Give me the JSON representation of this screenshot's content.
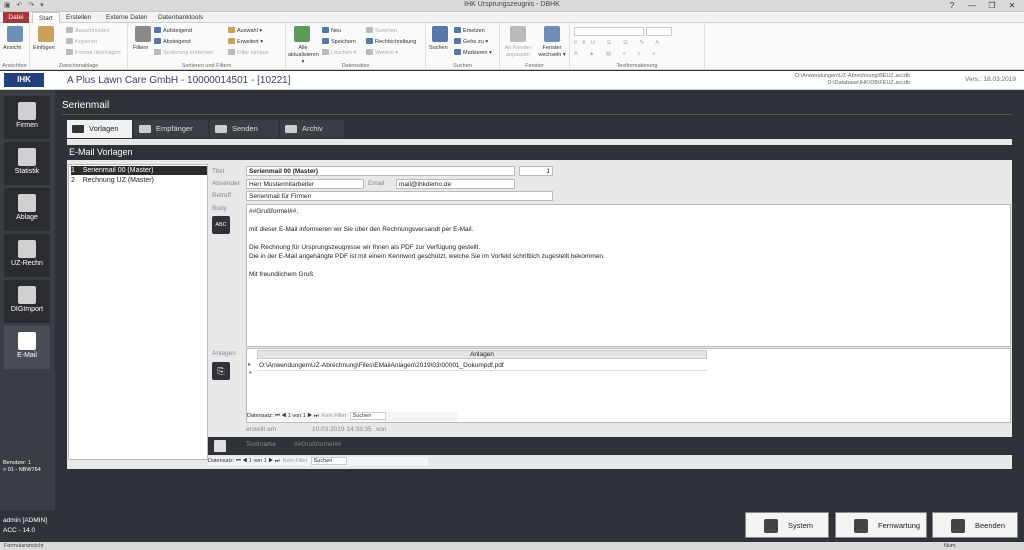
{
  "window": {
    "title": "IHK Ursprungszeugnis - DBHK",
    "min": "—",
    "restore": "❐",
    "close": "✕",
    "help": "?"
  },
  "ribbon_tabs": [
    "Datei",
    "Start",
    "Erstellen",
    "Externe Daten",
    "Datenbanktools"
  ],
  "ribbon": {
    "ansicht": {
      "btn": "Ansicht",
      "group": "Ansichten"
    },
    "clip": {
      "paste": "Einfügen",
      "cut": "Ausschneiden",
      "copy": "Kopieren",
      "format": "Format übertragen",
      "group": "Zwischenablage"
    },
    "sort": {
      "filter": "Filtern",
      "asc": "Aufsteigend",
      "desc": "Absteigend",
      "remove": "Sortierung entfernen",
      "sel": "Auswahl ▾",
      "adv": "Erweitert ▾",
      "toggle": "Filter ein/aus",
      "group": "Sortieren und Filtern"
    },
    "records": {
      "refresh": "Alle aktualisieren ▾",
      "new": "Neu",
      "save": "Speichern",
      "delete": "Löschen ▾",
      "sum": "Summen",
      "spell": "Rechtschreibung",
      "more": "Weitere ▾",
      "group": "Datensätze"
    },
    "find": {
      "search": "Suchen",
      "replace": "Ersetzen",
      "goto": "Gehe zu ▾",
      "mark": "Markieren ▾",
      "group": "Suchen"
    },
    "window": {
      "fit": "An Fenster anpassen",
      "switch": "Fenster wechseln ▾",
      "group": "Fenster"
    },
    "text": {
      "group": "Textformatierung"
    }
  },
  "header": {
    "logo": "IHK",
    "company": "A Plus Lawn Care GmbH - 10000014501 - [10221]",
    "path1": "O:\\Anwendungen\\UZ-Abrechnung\\BEUZ.accdb",
    "path2": "D:\\Database\\IHK\\DB\\FEUZ.accdb",
    "version": "Vers.: 18.03.2019"
  },
  "nav": [
    {
      "label": "Firmen"
    },
    {
      "label": "Statistik"
    },
    {
      "label": "Ablage"
    },
    {
      "label": "UZ-Rechn"
    },
    {
      "label": "DIGImport"
    },
    {
      "label": "E-Mail"
    }
  ],
  "user": {
    "line1": "Benutzer: 1",
    "line2": "> 01 - NBW764"
  },
  "section_title": "Serienmail",
  "subtabs": [
    "Vorlagen",
    "Empfänger",
    "Senden",
    "Archiv"
  ],
  "panel_title": "E-Mail Vorlagen",
  "templates": [
    {
      "num": "1",
      "name": "Serienmail 00 (Master)"
    },
    {
      "num": "2",
      "name": "Rechnung UZ (Master)"
    }
  ],
  "form": {
    "title_label": "Titel",
    "title_value": "Serienmail 00 (Master)",
    "title_num": "1",
    "sender_label": "Absender",
    "sender_value": "Herr Mustermitarbeiter",
    "email_label": "Email",
    "email_value": "mail@ihkdemo.de",
    "subject_label": "Betreff",
    "subject_value": "Serienmail für Firmen",
    "body_label": "Body",
    "abc": "ABC",
    "body_lines": [
      "##Grußformel##,",
      "",
      "mit dieser E-Mail informieren wir Sie über den Rechnungsversandt per E-Mail.",
      "",
      "Die Rechnung für Ursprungszeugnisse wir Ihnen als PDF zur Verfügung gestellt.",
      "Die in der E-Mail angehängte PDF ist mit einem Kennwort geschützt, welche Sie im Vorfeld schriftlich zugestellt bekommen.",
      "",
      "Mit freundlichem Gruß"
    ],
    "attach_label": "Anlagen",
    "attach_header": "Anlagen",
    "attach_row": "O:\\Anwendungen\\UZ-Abrechnung\\Files\\EMailAnlagen\\2019\\03\\00001_Dokumpdf.pdf",
    "new_marker": "*",
    "created_label": "erstellt am",
    "created_value": "10.03.2019 14:33:35",
    "von_label": "von",
    "textmarke_label": "Textmarke",
    "textmarke_value": "##Grußformel##"
  },
  "recnav": {
    "label": "Datensatz:",
    "first": "⏮",
    "prev": "◀",
    "pos": "1 von 1",
    "next": "▶",
    "last": "⏭",
    "nofilter": "Kein Filter",
    "search": "Suchen"
  },
  "bottom": {
    "user": "admin [ADMIN]",
    "acc": "ACC - 14.0",
    "system": "System",
    "fernwartung": "Fernwartung",
    "beenden": "Beenden"
  },
  "status": {
    "left": "Formularansicht",
    "num": "Num"
  }
}
